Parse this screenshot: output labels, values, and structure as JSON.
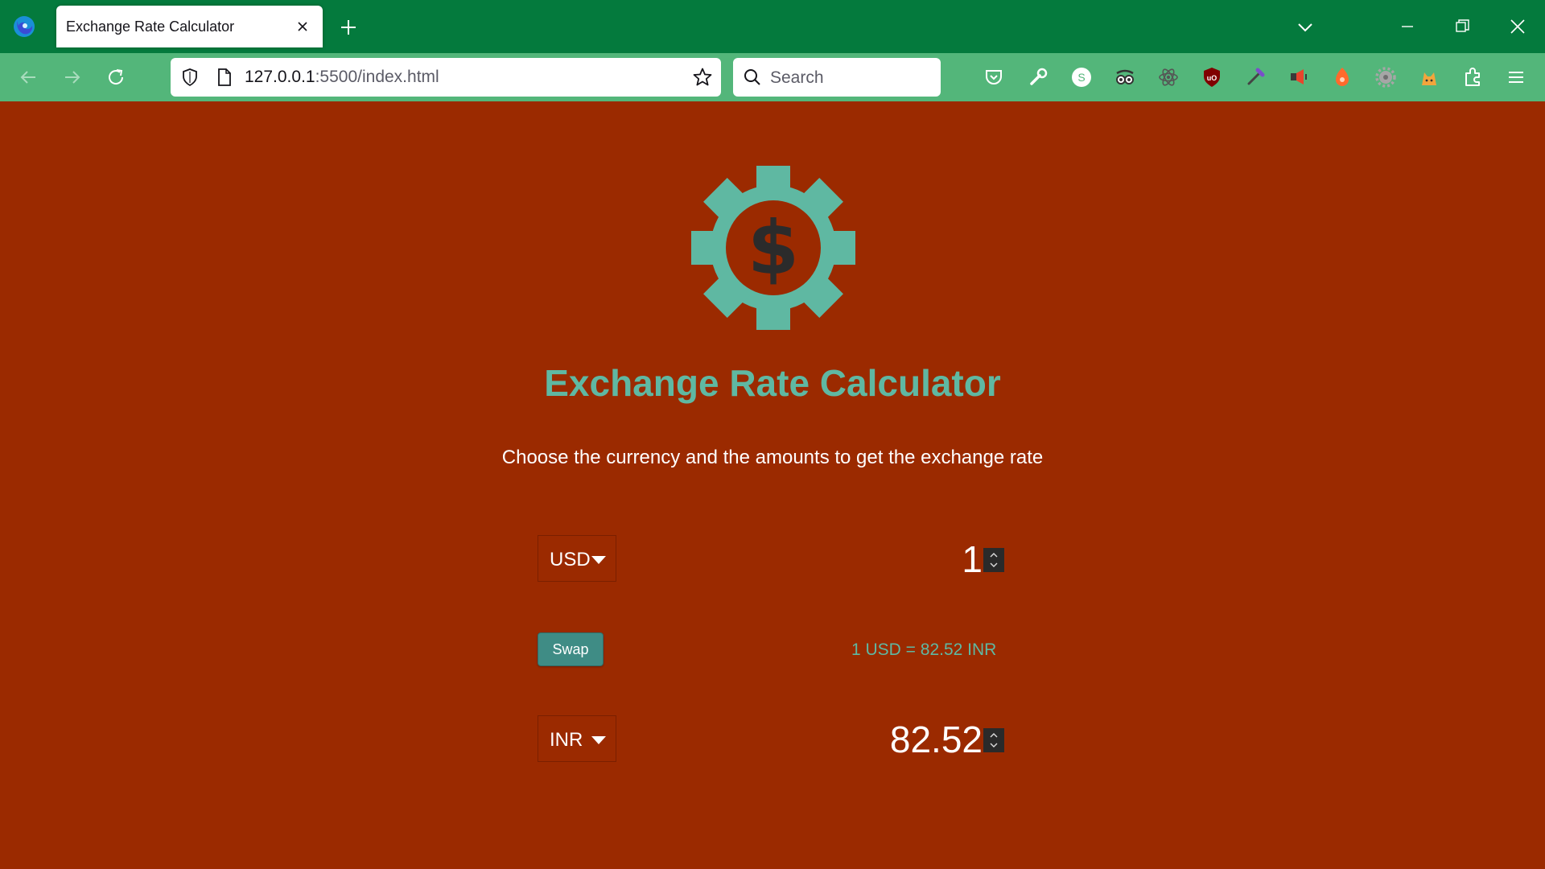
{
  "browser": {
    "tab_title": "Exchange Rate Calculator",
    "url_host": "127.0.0.1",
    "url_rest": ":5500/index.html",
    "search_placeholder": "Search",
    "theme_colors": {
      "tabbar": "#047a3d",
      "toolbar": "#53b67a"
    },
    "extensions": [
      "pocket-icon",
      "wrench-icon",
      "s-extension-icon",
      "glasses-icon",
      "react-devtools-icon",
      "ublock-origin-icon",
      "eyedropper-icon",
      "megaphone-icon",
      "orange-extension-icon",
      "gear-extension-icon",
      "cat-extension-icon",
      "extensions-puzzle-icon",
      "app-menu-icon"
    ]
  },
  "page": {
    "background": "#9b2a00",
    "accent": "#5fb8a2",
    "logo_icon": "dollar-gear-icon",
    "title": "Exchange Rate Calculator",
    "subtitle": "Choose the currency and the amounts to get the exchange rate",
    "from": {
      "currency": "USD",
      "amount": "1"
    },
    "to": {
      "currency": "INR",
      "amount": "82.52"
    },
    "swap_label": "Swap",
    "rate_text": "1 USD = 82.52 INR"
  }
}
